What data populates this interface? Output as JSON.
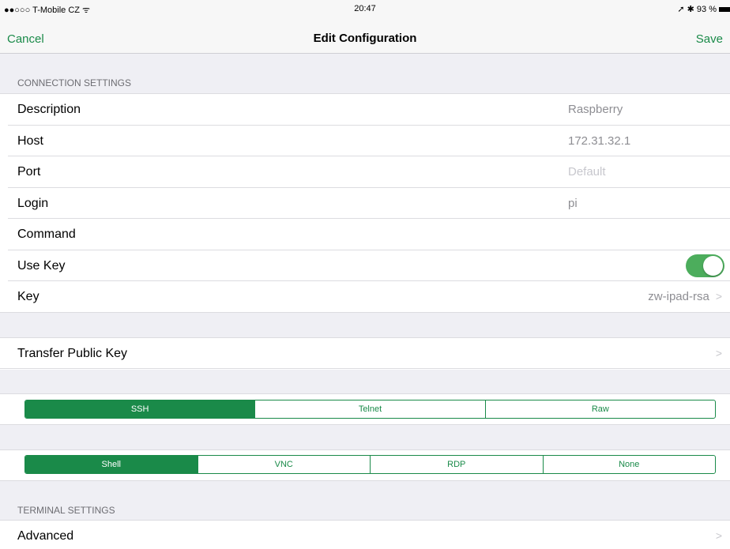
{
  "status_bar": {
    "carrier": "●●○○○ T-Mobile CZ ᯤ",
    "time": "20:47",
    "right": "➚ ✱ 93 %"
  },
  "nav": {
    "cancel": "Cancel",
    "title": "Edit Configuration",
    "save": "Save"
  },
  "connection": {
    "header": "CONNECTION SETTINGS",
    "rows": [
      {
        "label": "Description",
        "value": "Raspberry"
      },
      {
        "label": "Host",
        "value": "172.31.32.1"
      },
      {
        "label": "Port",
        "placeholder": "Default"
      },
      {
        "label": "Login",
        "value": "pi"
      },
      {
        "label": "Command",
        "value": ""
      },
      {
        "label": "Use Key",
        "toggle_on": true
      },
      {
        "label": "Key",
        "value": "zw-ipad-rsa"
      }
    ]
  },
  "transfer": {
    "label": "Transfer Public Key"
  },
  "protocol": {
    "options": [
      "SSH",
      "Telnet",
      "Raw"
    ],
    "selected": "SSH"
  },
  "mode": {
    "options": [
      "Shell",
      "VNC",
      "RDP",
      "None"
    ],
    "selected": "Shell"
  },
  "terminal": {
    "header": "TERMINAL SETTINGS",
    "advanced": "Advanced"
  },
  "colors": {
    "accent": "#1a8a49",
    "toggle": "#4cad5c"
  },
  "icons": {
    "chevron": "chevron-right-icon",
    "wifi": "wifi-icon",
    "battery": "battery-icon"
  }
}
